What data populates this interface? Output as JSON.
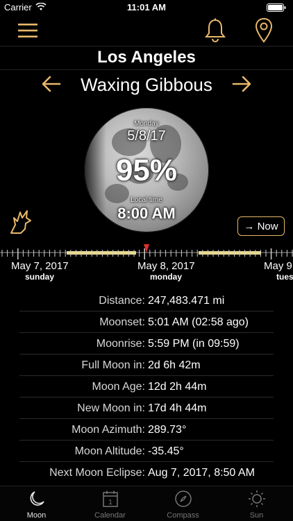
{
  "status_bar": {
    "carrier": "Carrier",
    "time": "11:01 AM"
  },
  "navbar": {
    "icons": [
      "menu-icon",
      "bell-icon",
      "location-pin-icon"
    ]
  },
  "city": "Los Angeles",
  "phase": {
    "name": "Waxing Gibbous"
  },
  "moon": {
    "day": "Monday",
    "date": "5/8/17",
    "illumination": "95%",
    "time_label": "Local time",
    "time": "8:00 AM"
  },
  "now_button": "→ Now",
  "timeline": {
    "dates": [
      {
        "date": "May 7, 2017",
        "day": "sunday"
      },
      {
        "date": "May 8, 2017",
        "day": "monday"
      },
      {
        "date": "May 9",
        "day": "tues"
      }
    ]
  },
  "info_rows": [
    {
      "label": "Distance:",
      "value": "247,483.471 mi"
    },
    {
      "label": "Moonset:",
      "value": "5:01 AM (02:58 ago)"
    },
    {
      "label": "Moonrise:",
      "value": "5:59 PM (in 09:59)"
    },
    {
      "label": "Full Moon in:",
      "value": "2d 6h 42m"
    },
    {
      "label": "Moon Age:",
      "value": "12d 2h 44m"
    },
    {
      "label": "New Moon in:",
      "value": "17d 4h 44m"
    },
    {
      "label": "Moon Azimuth:",
      "value": "289.73°"
    },
    {
      "label": "Moon Altitude:",
      "value": "-35.45°"
    },
    {
      "label": "Next Moon Eclipse:",
      "value": "Aug 7, 2017, 8:50 AM"
    }
  ],
  "tabs": [
    {
      "label": "Moon",
      "icon": "moon-icon",
      "active": true
    },
    {
      "label": "Calendar",
      "icon": "calendar-icon",
      "calendar_number": "1"
    },
    {
      "label": "Compass",
      "icon": "compass-icon"
    },
    {
      "label": "Sun",
      "icon": "sun-icon"
    }
  ],
  "colors": {
    "accent": "#e8b96a",
    "background": "#000000",
    "timeline_yellow": "#e6d98a",
    "marker_red": "#e0302a"
  }
}
